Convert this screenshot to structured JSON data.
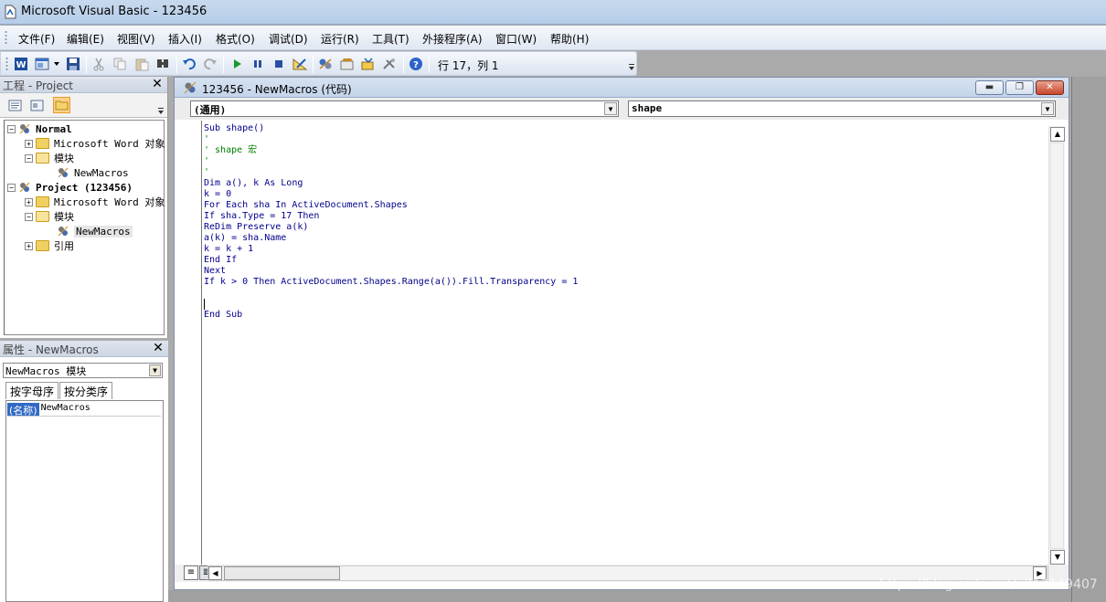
{
  "window": {
    "title": "Microsoft Visual Basic - 123456"
  },
  "menu": [
    "文件(F)",
    "编辑(E)",
    "视图(V)",
    "插入(I)",
    "格式(O)",
    "调试(D)",
    "运行(R)",
    "工具(T)",
    "外接程序(A)",
    "窗口(W)",
    "帮助(H)"
  ],
  "toolbar": {
    "status": "行 17，列 1"
  },
  "project_panel": {
    "title": "工程 - Project",
    "tree": [
      {
        "label": "Normal",
        "bold": true
      },
      {
        "label": "Microsoft Word 对象"
      },
      {
        "label": "模块"
      },
      {
        "label": "NewMacros"
      },
      {
        "label": "Project (123456)",
        "bold": true
      },
      {
        "label": "Microsoft Word 对象"
      },
      {
        "label": "模块"
      },
      {
        "label": "NewMacros"
      },
      {
        "label": "引用"
      }
    ]
  },
  "properties_panel": {
    "title": "属性 - NewMacros",
    "object": "NewMacros 模块",
    "tabs": [
      "按字母序",
      "按分类序"
    ],
    "row": {
      "name": "(名称)",
      "value": "NewMacros"
    }
  },
  "code_window": {
    "title": "123456 - NewMacros (代码)",
    "object_combo": "(通用)",
    "proc_combo": "shape",
    "lines": [
      {
        "text": "Sub shape()",
        "type": "code"
      },
      {
        "text": "'",
        "type": "comment"
      },
      {
        "text": "' shape 宏",
        "type": "comment"
      },
      {
        "text": "'",
        "type": "comment"
      },
      {
        "text": "'",
        "type": "comment"
      },
      {
        "text": "Dim a(), k As Long",
        "type": "code"
      },
      {
        "text": "k = 0",
        "type": "code"
      },
      {
        "text": "For Each sha In ActiveDocument.Shapes",
        "type": "code"
      },
      {
        "text": "If sha.Type = 17 Then",
        "type": "code"
      },
      {
        "text": "ReDim Preserve a(k)",
        "type": "code"
      },
      {
        "text": "a(k) = sha.Name",
        "type": "code"
      },
      {
        "text": "k = k + 1",
        "type": "code"
      },
      {
        "text": "End If",
        "type": "code"
      },
      {
        "text": "Next",
        "type": "code"
      },
      {
        "text": "If k > 0 Then ActiveDocument.Shapes.Range(a()).Fill.Transparency = 1",
        "type": "code"
      },
      {
        "text": "",
        "type": "code"
      },
      {
        "text": "",
        "type": "caret"
      },
      {
        "text": "End Sub",
        "type": "code"
      }
    ]
  },
  "watermark": "https://blog.csdn.net/u013149407"
}
